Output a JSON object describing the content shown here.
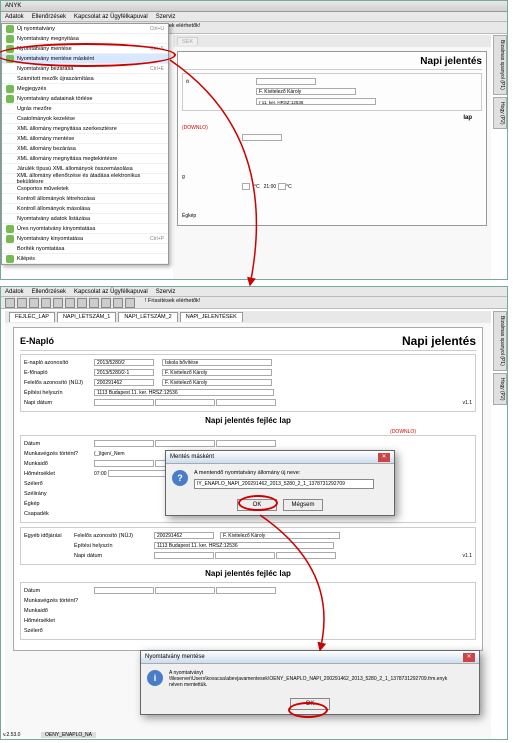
{
  "app_title": "ANYK",
  "menubar": [
    "Adatok",
    "Ellenőrzések",
    "Kapcsolat az Ügyfélkapuval",
    "Szerviz"
  ],
  "dropdown": [
    {
      "label": "Új nyomtatvány",
      "kb": "Ctrl+U",
      "icon": true
    },
    {
      "label": "Nyomtatvány megnyitása",
      "kb": "",
      "icon": true
    },
    {
      "label": "Nyomtatvány mentése",
      "kb": "Ctrl+S",
      "icon": true
    },
    {
      "label": "Nyomtatvány mentése másként",
      "kb": "",
      "icon": true,
      "hl": true
    },
    {
      "label": "Nyomtatvány bezárása",
      "kb": "Ctrl+E",
      "icon": false
    },
    {
      "label": "Számított mezők újraszámítása",
      "kb": "",
      "icon": false
    },
    {
      "label": "Megjegyzés",
      "kb": "",
      "icon": true
    },
    {
      "label": "Nyomtatvány adatainak törlése",
      "kb": "",
      "icon": true
    },
    {
      "label": "Ugrás mezőre",
      "kb": "",
      "icon": false
    },
    {
      "label": "Csatolmányok kezelése",
      "kb": "",
      "icon": false
    },
    {
      "label": "XML állomány megnyitása szerkesztésre",
      "kb": "",
      "icon": false
    },
    {
      "label": "XML állomány mentése",
      "kb": "",
      "icon": false
    },
    {
      "label": "XML állomány bezárása",
      "kb": "",
      "icon": false
    },
    {
      "label": "XML állomány megnyitása megtekintésre",
      "kb": "",
      "icon": false
    },
    {
      "label": "Járulék típusú XML állományok összemásolása",
      "kb": "",
      "icon": false
    },
    {
      "label": "XML állomány ellenőrzése és átadása elektronikus beküldésre",
      "kb": "",
      "icon": false
    },
    {
      "label": "Csoportos műveletek",
      "kb": "",
      "icon": false
    },
    {
      "label": "Kontroll állományok létrehozása",
      "kb": "",
      "icon": false
    },
    {
      "label": "Kontroll állományok másolása",
      "kb": "",
      "icon": false
    },
    {
      "label": "Nyomtatvány adatok listázása",
      "kb": "",
      "icon": false
    },
    {
      "label": "Üres nyomtatvány kinyomtatása",
      "kb": "",
      "icon": true
    },
    {
      "label": "Nyomtatvány kinyomtatása",
      "kb": "Ctrl+P",
      "icon": true
    },
    {
      "label": "Boríték nyomtatása",
      "kb": "",
      "icon": false
    },
    {
      "label": "Kilépés",
      "kb": "",
      "icon": true
    }
  ],
  "friss": "! Frissítések elérhetők!",
  "tabs": [
    "FEJLÉC_LAP",
    "NAPI_LÉTSZÁM_1",
    "NAPI_LÉTSZÁM_2",
    "NAPI_JELENTÉSEK"
  ],
  "enaplo": "E-Napló",
  "napi": "Napi jelentés",
  "fields": {
    "enaplo_az_l": "E-napló azonosító",
    "enaplo_az_v": "2013/5280/2",
    "efonaplo_l": "E-főnapló",
    "efonaplo_v": "2013/5280/2-1",
    "felelos_l": "Felelős azonosító (NÜJ)",
    "felelos_v": "200291462",
    "epitesi_l": "Építési helyszín",
    "napi_datum_l": "Napi dátum",
    "iskola": "Iskola bővítése",
    "kivitelezo": "F. Kivitelező Károly",
    "cim": "1113 Budapest 11. ker. HRSZ:12536",
    "ver": "v1.1"
  },
  "section_title": "Napi jelentés fejléc lap",
  "body_fields": {
    "datum": "Dátum",
    "munkavegzes": "Munkavégzés történt?",
    "igen_nem": "(_)Igen/_Nem",
    "munkaido": "Munkaidő",
    "homerseklet": "Hőmérséklet",
    "hom1": "07:00",
    "hom2": "°C",
    "hom3": "°C",
    "hom4": "21:00",
    "hom5": "°C",
    "szelero": "Szélerő",
    "szelirany": "Szélirány",
    "egkep": "Égkép",
    "csapadek": "Csapadék",
    "egyeb": "Egyéb időjárási"
  },
  "download": "(DOWNLO)",
  "dialog1": {
    "title": "Mentés másként",
    "msg": "A mentendő nyomtatvány állomány új neve:",
    "value": "IY_ENAPLO_NAPI_200291462_2013_5280_2_1_1378731292709",
    "ok": "OK",
    "cancel": "Mégsem"
  },
  "dialog2": {
    "title": "Nyomtatvány mentése",
    "msg1": "A nyomtatványt",
    "msg2": "\\fileserver\\Users\\kovacsa\\abevjavamentesek\\OENY_ENAPLO_NAPI_200291462_2013_5280_2_1_1378731292709.frm.enyk",
    "msg3": "néven mentettük.",
    "ok": "OK"
  },
  "sidetabs": [
    "Bizalmas spanyol (P1)",
    "Hogy (P2)"
  ],
  "version": "v.2.53.0",
  "formid": "OENY_ENAPLO_NA"
}
